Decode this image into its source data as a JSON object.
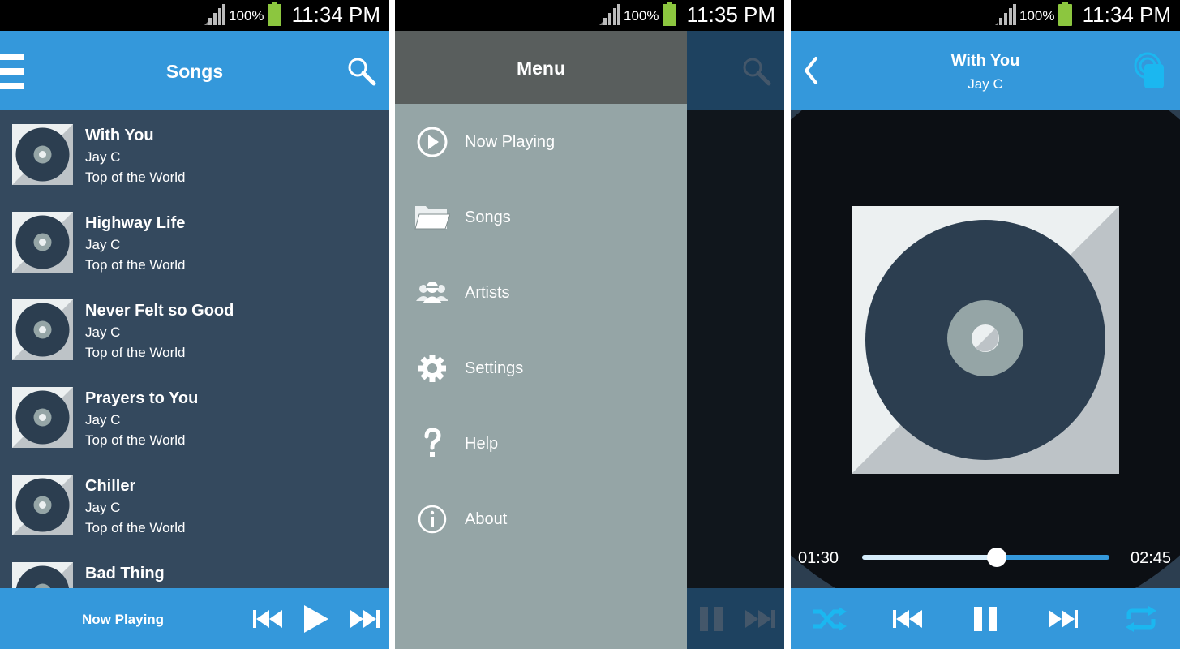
{
  "status_bar": {
    "screen1": {
      "battery": "100%",
      "time": "11:34 PM"
    },
    "screen2": {
      "battery": "100%",
      "time": "11:35 PM"
    },
    "screen3": {
      "battery": "100%",
      "time": "11:34 PM"
    }
  },
  "songs_screen": {
    "title": "Songs",
    "menu_icon": "hamburger-icon",
    "search_icon": "search-icon",
    "songs": [
      {
        "title": "With You",
        "artist": "Jay C",
        "album": "Top of the World"
      },
      {
        "title": "Highway Life",
        "artist": "Jay C",
        "album": "Top of the World"
      },
      {
        "title": "Never Felt so Good",
        "artist": "Jay C",
        "album": "Top of the World"
      },
      {
        "title": "Prayers to You",
        "artist": "Jay C",
        "album": "Top of the World"
      },
      {
        "title": "Chiller",
        "artist": "Jay C",
        "album": "Top of the World"
      },
      {
        "title": "Bad Thing",
        "artist": "",
        "album": ""
      }
    ],
    "bottom_bar": {
      "label": "Now Playing",
      "icons": [
        "previous-icon",
        "play-icon",
        "next-icon"
      ]
    }
  },
  "menu_screen": {
    "title": "Menu",
    "items": [
      {
        "label": "Now Playing",
        "icon": "play-circle-icon"
      },
      {
        "label": "Songs",
        "icon": "folder-icon"
      },
      {
        "label": "Artists",
        "icon": "people-icon"
      },
      {
        "label": "Settings",
        "icon": "gear-icon"
      },
      {
        "label": "Help",
        "icon": "question-icon"
      },
      {
        "label": "About",
        "icon": "info-icon"
      }
    ]
  },
  "player_screen": {
    "title": "With You",
    "artist": "Jay C",
    "elapsed": "01:30",
    "duration": "02:45",
    "progress_fraction": 0.545,
    "icons": [
      "back-icon",
      "touch-icon",
      "shuffle-icon",
      "previous-icon",
      "pause-icon",
      "next-icon",
      "repeat-icon"
    ]
  },
  "colors": {
    "accent": "#3498db",
    "list_background": "#34495e",
    "drawer_background": "#95a5a6",
    "drawer_header": "#595e5d",
    "highlight_icon": "#1bb7f0"
  }
}
